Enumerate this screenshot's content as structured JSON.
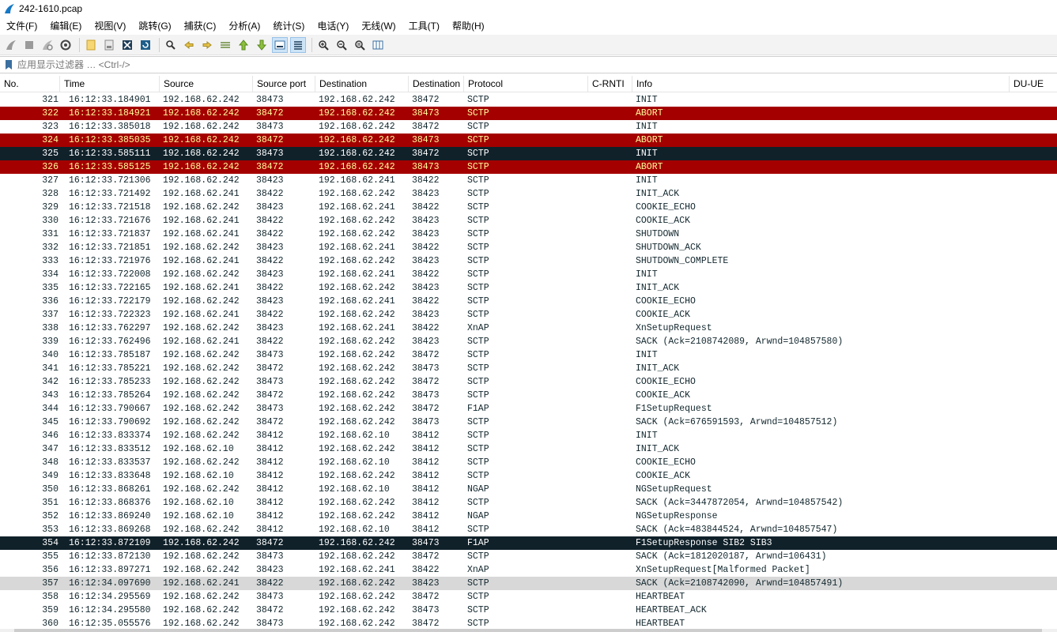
{
  "window": {
    "title": "242-1610.pcap"
  },
  "menu": [
    "文件(F)",
    "编辑(E)",
    "视图(V)",
    "跳转(G)",
    "捕获(C)",
    "分析(A)",
    "统计(S)",
    "电话(Y)",
    "无线(W)",
    "工具(T)",
    "帮助(H)"
  ],
  "filter": {
    "placeholder": "应用显示过滤器 … <Ctrl-/>"
  },
  "columns": [
    "No.",
    "Time",
    "Source",
    "Source port",
    "Destination",
    "Destination port",
    "Protocol",
    "C-RNTI",
    "Info",
    "DU-UE"
  ],
  "colors": {
    "bad_tcp_bg": "#a40000",
    "bad_tcp_fg": "#fffc9c",
    "selected_bg": "#10212a",
    "marked_bg": "#d8d8d8"
  },
  "packets": [
    {
      "no": "321",
      "time": "16:12:33.184901",
      "src": "192.168.62.242",
      "sport": "38473",
      "dst": "192.168.62.242",
      "dport": "38472",
      "proto": "SCTP",
      "info": "INIT",
      "style": ""
    },
    {
      "no": "322",
      "time": "16:12:33.184921",
      "src": "192.168.62.242",
      "sport": "38472",
      "dst": "192.168.62.242",
      "dport": "38473",
      "proto": "SCTP",
      "info": "ABORT",
      "style": "red"
    },
    {
      "no": "323",
      "time": "16:12:33.385018",
      "src": "192.168.62.242",
      "sport": "38473",
      "dst": "192.168.62.242",
      "dport": "38472",
      "proto": "SCTP",
      "info": "INIT",
      "style": ""
    },
    {
      "no": "324",
      "time": "16:12:33.385035",
      "src": "192.168.62.242",
      "sport": "38472",
      "dst": "192.168.62.242",
      "dport": "38473",
      "proto": "SCTP",
      "info": "ABORT",
      "style": "red"
    },
    {
      "no": "325",
      "time": "16:12:33.585111",
      "src": "192.168.62.242",
      "sport": "38473",
      "dst": "192.168.62.242",
      "dport": "38472",
      "proto": "SCTP",
      "info": "INIT",
      "style": "sel"
    },
    {
      "no": "326",
      "time": "16:12:33.585125",
      "src": "192.168.62.242",
      "sport": "38472",
      "dst": "192.168.62.242",
      "dport": "38473",
      "proto": "SCTP",
      "info": "ABORT",
      "style": "red"
    },
    {
      "no": "327",
      "time": "16:12:33.721306",
      "src": "192.168.62.242",
      "sport": "38423",
      "dst": "192.168.62.241",
      "dport": "38422",
      "proto": "SCTP",
      "info": "INIT",
      "style": ""
    },
    {
      "no": "328",
      "time": "16:12:33.721492",
      "src": "192.168.62.241",
      "sport": "38422",
      "dst": "192.168.62.242",
      "dport": "38423",
      "proto": "SCTP",
      "info": "INIT_ACK",
      "style": ""
    },
    {
      "no": "329",
      "time": "16:12:33.721518",
      "src": "192.168.62.242",
      "sport": "38423",
      "dst": "192.168.62.241",
      "dport": "38422",
      "proto": "SCTP",
      "info": "COOKIE_ECHO",
      "style": ""
    },
    {
      "no": "330",
      "time": "16:12:33.721676",
      "src": "192.168.62.241",
      "sport": "38422",
      "dst": "192.168.62.242",
      "dport": "38423",
      "proto": "SCTP",
      "info": "COOKIE_ACK",
      "style": ""
    },
    {
      "no": "331",
      "time": "16:12:33.721837",
      "src": "192.168.62.241",
      "sport": "38422",
      "dst": "192.168.62.242",
      "dport": "38423",
      "proto": "SCTP",
      "info": "SHUTDOWN",
      "style": ""
    },
    {
      "no": "332",
      "time": "16:12:33.721851",
      "src": "192.168.62.242",
      "sport": "38423",
      "dst": "192.168.62.241",
      "dport": "38422",
      "proto": "SCTP",
      "info": "SHUTDOWN_ACK",
      "style": ""
    },
    {
      "no": "333",
      "time": "16:12:33.721976",
      "src": "192.168.62.241",
      "sport": "38422",
      "dst": "192.168.62.242",
      "dport": "38423",
      "proto": "SCTP",
      "info": "SHUTDOWN_COMPLETE",
      "style": ""
    },
    {
      "no": "334",
      "time": "16:12:33.722008",
      "src": "192.168.62.242",
      "sport": "38423",
      "dst": "192.168.62.241",
      "dport": "38422",
      "proto": "SCTP",
      "info": "INIT",
      "style": ""
    },
    {
      "no": "335",
      "time": "16:12:33.722165",
      "src": "192.168.62.241",
      "sport": "38422",
      "dst": "192.168.62.242",
      "dport": "38423",
      "proto": "SCTP",
      "info": "INIT_ACK",
      "style": ""
    },
    {
      "no": "336",
      "time": "16:12:33.722179",
      "src": "192.168.62.242",
      "sport": "38423",
      "dst": "192.168.62.241",
      "dport": "38422",
      "proto": "SCTP",
      "info": "COOKIE_ECHO",
      "style": ""
    },
    {
      "no": "337",
      "time": "16:12:33.722323",
      "src": "192.168.62.241",
      "sport": "38422",
      "dst": "192.168.62.242",
      "dport": "38423",
      "proto": "SCTP",
      "info": "COOKIE_ACK",
      "style": ""
    },
    {
      "no": "338",
      "time": "16:12:33.762297",
      "src": "192.168.62.242",
      "sport": "38423",
      "dst": "192.168.62.241",
      "dport": "38422",
      "proto": "XnAP",
      "info": "XnSetupRequest",
      "style": ""
    },
    {
      "no": "339",
      "time": "16:12:33.762496",
      "src": "192.168.62.241",
      "sport": "38422",
      "dst": "192.168.62.242",
      "dport": "38423",
      "proto": "SCTP",
      "info": "SACK (Ack=2108742089, Arwnd=104857580)",
      "style": ""
    },
    {
      "no": "340",
      "time": "16:12:33.785187",
      "src": "192.168.62.242",
      "sport": "38473",
      "dst": "192.168.62.242",
      "dport": "38472",
      "proto": "SCTP",
      "info": "INIT",
      "style": ""
    },
    {
      "no": "341",
      "time": "16:12:33.785221",
      "src": "192.168.62.242",
      "sport": "38472",
      "dst": "192.168.62.242",
      "dport": "38473",
      "proto": "SCTP",
      "info": "INIT_ACK",
      "style": ""
    },
    {
      "no": "342",
      "time": "16:12:33.785233",
      "src": "192.168.62.242",
      "sport": "38473",
      "dst": "192.168.62.242",
      "dport": "38472",
      "proto": "SCTP",
      "info": "COOKIE_ECHO",
      "style": ""
    },
    {
      "no": "343",
      "time": "16:12:33.785264",
      "src": "192.168.62.242",
      "sport": "38472",
      "dst": "192.168.62.242",
      "dport": "38473",
      "proto": "SCTP",
      "info": "COOKIE_ACK",
      "style": ""
    },
    {
      "no": "344",
      "time": "16:12:33.790667",
      "src": "192.168.62.242",
      "sport": "38473",
      "dst": "192.168.62.242",
      "dport": "38472",
      "proto": "F1AP",
      "info": "F1SetupRequest",
      "style": ""
    },
    {
      "no": "345",
      "time": "16:12:33.790692",
      "src": "192.168.62.242",
      "sport": "38472",
      "dst": "192.168.62.242",
      "dport": "38473",
      "proto": "SCTP",
      "info": "SACK (Ack=676591593, Arwnd=104857512)",
      "style": ""
    },
    {
      "no": "346",
      "time": "16:12:33.833374",
      "src": "192.168.62.242",
      "sport": "38412",
      "dst": "192.168.62.10",
      "dport": "38412",
      "proto": "SCTP",
      "info": "INIT",
      "style": ""
    },
    {
      "no": "347",
      "time": "16:12:33.833512",
      "src": "192.168.62.10",
      "sport": "38412",
      "dst": "192.168.62.242",
      "dport": "38412",
      "proto": "SCTP",
      "info": "INIT_ACK",
      "style": ""
    },
    {
      "no": "348",
      "time": "16:12:33.833537",
      "src": "192.168.62.242",
      "sport": "38412",
      "dst": "192.168.62.10",
      "dport": "38412",
      "proto": "SCTP",
      "info": "COOKIE_ECHO",
      "style": ""
    },
    {
      "no": "349",
      "time": "16:12:33.833648",
      "src": "192.168.62.10",
      "sport": "38412",
      "dst": "192.168.62.242",
      "dport": "38412",
      "proto": "SCTP",
      "info": "COOKIE_ACK",
      "style": ""
    },
    {
      "no": "350",
      "time": "16:12:33.868261",
      "src": "192.168.62.242",
      "sport": "38412",
      "dst": "192.168.62.10",
      "dport": "38412",
      "proto": "NGAP",
      "info": "NGSetupRequest",
      "style": ""
    },
    {
      "no": "351",
      "time": "16:12:33.868376",
      "src": "192.168.62.10",
      "sport": "38412",
      "dst": "192.168.62.242",
      "dport": "38412",
      "proto": "SCTP",
      "info": "SACK (Ack=3447872054, Arwnd=104857542)",
      "style": ""
    },
    {
      "no": "352",
      "time": "16:12:33.869240",
      "src": "192.168.62.10",
      "sport": "38412",
      "dst": "192.168.62.242",
      "dport": "38412",
      "proto": "NGAP",
      "info": "NGSetupResponse",
      "style": ""
    },
    {
      "no": "353",
      "time": "16:12:33.869268",
      "src": "192.168.62.242",
      "sport": "38412",
      "dst": "192.168.62.10",
      "dport": "38412",
      "proto": "SCTP",
      "info": "SACK (Ack=483844524, Arwnd=104857547)",
      "style": ""
    },
    {
      "no": "354",
      "time": "16:12:33.872109",
      "src": "192.168.62.242",
      "sport": "38472",
      "dst": "192.168.62.242",
      "dport": "38473",
      "proto": "F1AP",
      "info": "F1SetupResponse SIB2 SIB3",
      "style": "sel"
    },
    {
      "no": "355",
      "time": "16:12:33.872130",
      "src": "192.168.62.242",
      "sport": "38473",
      "dst": "192.168.62.242",
      "dport": "38472",
      "proto": "SCTP",
      "info": "SACK (Ack=1812020187, Arwnd=106431)",
      "style": ""
    },
    {
      "no": "356",
      "time": "16:12:33.897271",
      "src": "192.168.62.242",
      "sport": "38423",
      "dst": "192.168.62.241",
      "dport": "38422",
      "proto": "XnAP",
      "info": "XnSetupRequest[Malformed Packet]",
      "style": ""
    },
    {
      "no": "357",
      "time": "16:12:34.097690",
      "src": "192.168.62.241",
      "sport": "38422",
      "dst": "192.168.62.242",
      "dport": "38423",
      "proto": "SCTP",
      "info": "SACK (Ack=2108742090, Arwnd=104857491)",
      "style": "gray"
    },
    {
      "no": "358",
      "time": "16:12:34.295569",
      "src": "192.168.62.242",
      "sport": "38473",
      "dst": "192.168.62.242",
      "dport": "38472",
      "proto": "SCTP",
      "info": "HEARTBEAT",
      "style": ""
    },
    {
      "no": "359",
      "time": "16:12:34.295580",
      "src": "192.168.62.242",
      "sport": "38472",
      "dst": "192.168.62.242",
      "dport": "38473",
      "proto": "SCTP",
      "info": "HEARTBEAT_ACK",
      "style": ""
    },
    {
      "no": "360",
      "time": "16:12:35.055576",
      "src": "192.168.62.242",
      "sport": "38473",
      "dst": "192.168.62.242",
      "dport": "38472",
      "proto": "SCTP",
      "info": "HEARTBEAT",
      "style": ""
    }
  ]
}
